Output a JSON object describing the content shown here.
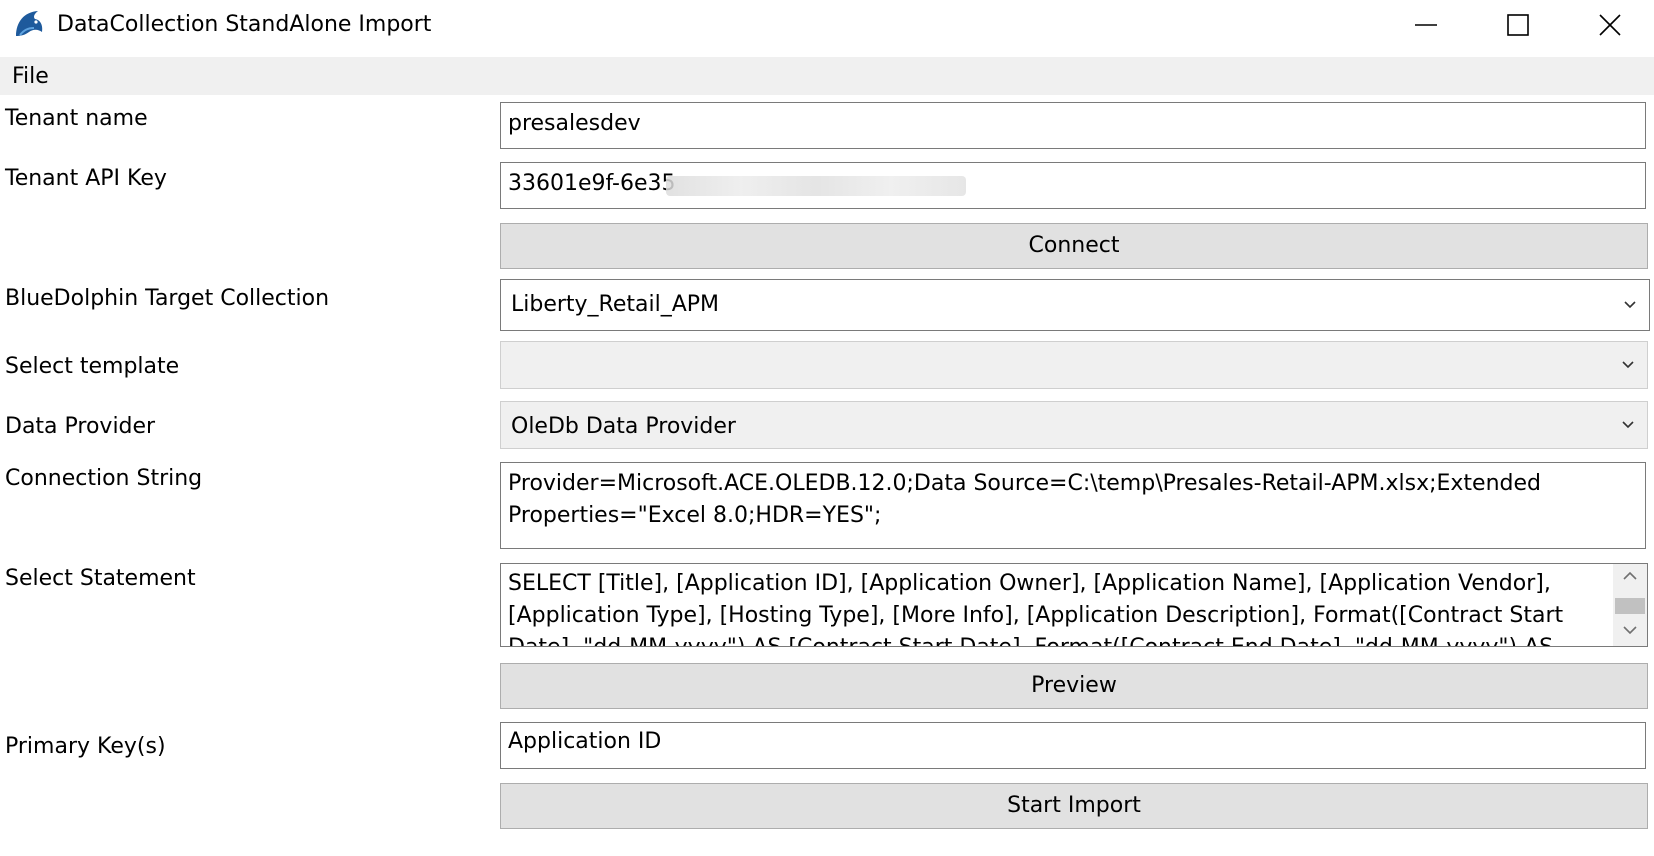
{
  "window": {
    "title": "DataCollection StandAlone Import"
  },
  "menu": {
    "file_label": "File"
  },
  "form": {
    "tenant_name": {
      "label": "Tenant name",
      "value": "presalesdev"
    },
    "tenant_api_key": {
      "label": "Tenant API Key",
      "value": "33601e9f-6e35"
    },
    "connect_button": "Connect",
    "target_collection": {
      "label": "BlueDolphin Target Collection",
      "value": "Liberty_Retail_APM"
    },
    "template": {
      "label": "Select template",
      "value": ""
    },
    "data_provider": {
      "label": "Data Provider",
      "value": "OleDb Data Provider"
    },
    "connection_string": {
      "label": "Connection String",
      "value": "Provider=Microsoft.ACE.OLEDB.12.0;Data Source=C:\\temp\\Presales-Retail-APM.xlsx;Extended Properties=\"Excel 8.0;HDR=YES\";"
    },
    "select_statement": {
      "label": "Select Statement",
      "value": "SELECT [Title], [Application ID], [Application Owner], [Application Name], [Application Vendor], [Application Type], [Hosting Type], [More Info], [Application Description], Format([Contract Start Date], \"dd-MM-yyyy\") AS [Contract Start Date], Format([Contract End Date], \"dd-MM-yyyy\") AS [Contract End Date]"
    },
    "preview_button": "Preview",
    "primary_keys": {
      "label": "Primary Key(s)",
      "value": "Application ID"
    },
    "start_import_button": "Start Import"
  },
  "colors": {
    "button_bg": "#e1e1e1",
    "menubar_bg": "#f0f0f0",
    "logo_blue": "#1e5a9c"
  },
  "icons": [
    "dolphin-logo-icon",
    "minimize-icon",
    "maximize-icon",
    "close-icon",
    "chevron-down-icon",
    "scroll-up-icon",
    "scroll-down-icon"
  ]
}
